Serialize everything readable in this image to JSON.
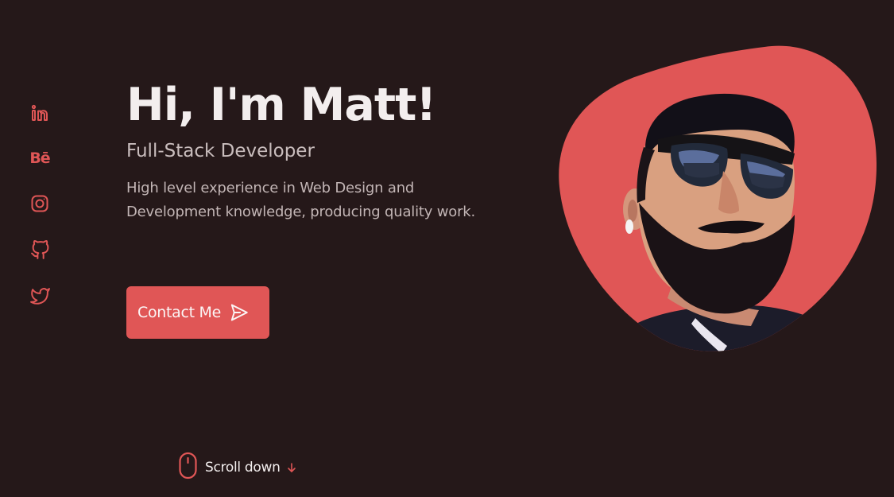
{
  "social": {
    "items": [
      {
        "name": "linkedin",
        "icon": "linkedin-icon"
      },
      {
        "name": "behance",
        "icon": "behance-icon",
        "glyph": "Bē"
      },
      {
        "name": "instagram",
        "icon": "instagram-icon"
      },
      {
        "name": "github",
        "icon": "github-icon"
      },
      {
        "name": "twitter",
        "icon": "twitter-icon"
      }
    ]
  },
  "hero": {
    "title": "Hi, I'm Matt!",
    "subtitle": "Full-Stack Developer",
    "description": "High level experience in Web Design and Development knowledge, producing quality work."
  },
  "contact_button": {
    "label": "Contact Me",
    "icon": "send-icon"
  },
  "scroll": {
    "label": "Scroll down",
    "mouse_icon": "mouse-icon",
    "arrow_icon": "arrow-down-icon"
  },
  "portrait": {
    "icon": "profile-photo"
  },
  "colors": {
    "background": "#251819",
    "accent": "#e05656",
    "text_primary": "#f3eeee",
    "text_secondary": "#c2b5b5"
  }
}
